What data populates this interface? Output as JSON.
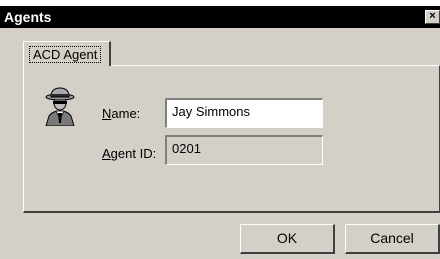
{
  "window": {
    "title": "Agents",
    "close_glyph": "×"
  },
  "tabs": [
    {
      "label": "ACD Agent",
      "selected": true
    }
  ],
  "form": {
    "icon": "spy-agent-icon",
    "name_label": {
      "accel": "N",
      "rest": "ame:"
    },
    "name_value": "Jay Simmons",
    "agentid_label": {
      "accel": "A",
      "rest": "gent ID:"
    },
    "agentid_value": "0201"
  },
  "buttons": {
    "ok": "OK",
    "cancel": "Cancel"
  },
  "colors": {
    "face": "#d4d0c8",
    "titlebar": "#000000",
    "title_text": "#ffffff"
  }
}
